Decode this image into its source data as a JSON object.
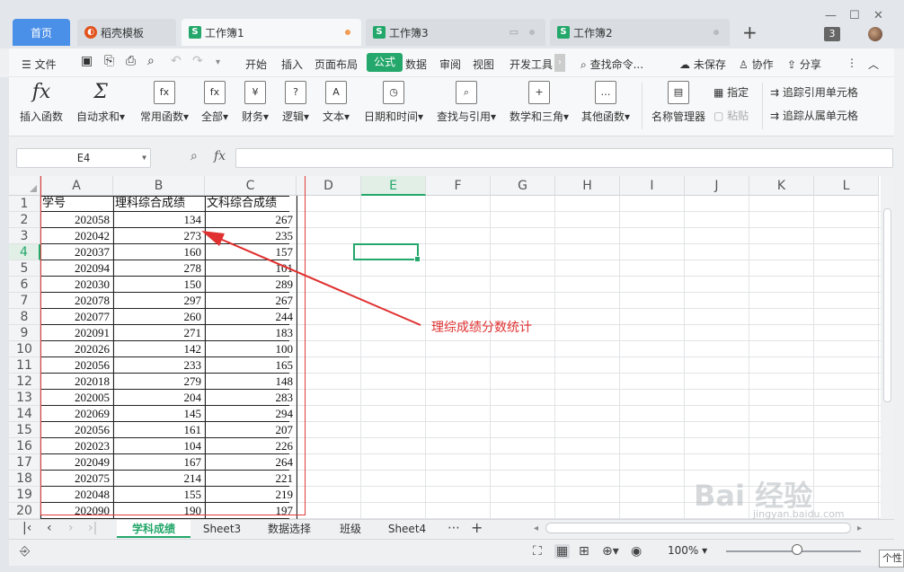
{
  "tabs": [
    {
      "label": "首页",
      "type": "home"
    },
    {
      "label": "稻壳模板",
      "type": "docer"
    },
    {
      "label": "工作簿1",
      "type": "active"
    },
    {
      "label": "工作簿3",
      "type": "normal"
    },
    {
      "label": "工作簿2",
      "type": "normal"
    }
  ],
  "window_badge": "3",
  "menu": {
    "file": "文件",
    "items": [
      "开始",
      "插入",
      "页面布局",
      "公式",
      "数据",
      "审阅",
      "视图",
      "开发工具"
    ],
    "active": "公式",
    "search": "查找命令...",
    "unsaved": "未保存",
    "collab": "协作",
    "share": "分享"
  },
  "ribbon": {
    "buttons": [
      {
        "label": "插入函数",
        "icon": "fx"
      },
      {
        "label": "自动求和",
        "icon": "Σ"
      },
      {
        "label": "常用函数",
        "icon": "fx"
      },
      {
        "label": "全部",
        "icon": "fx"
      },
      {
        "label": "财务",
        "icon": "¥"
      },
      {
        "label": "逻辑",
        "icon": "?"
      },
      {
        "label": "文本",
        "icon": "A"
      },
      {
        "label": "日期和时间",
        "icon": "◷"
      },
      {
        "label": "查找与引用",
        "icon": "⌕"
      },
      {
        "label": "数学和三角",
        "icon": "+"
      },
      {
        "label": "其他函数",
        "icon": "…"
      },
      {
        "label": "名称管理器",
        "icon": "▤"
      }
    ],
    "specify": "指定",
    "paste": "粘贴",
    "trace_precedents": "追踪引用单元格",
    "trace_dependents": "追踪从属单元格"
  },
  "namebox": "E4",
  "columns": [
    "A",
    "B",
    "C",
    "D",
    "E",
    "F",
    "G",
    "H",
    "I",
    "J",
    "K",
    "L"
  ],
  "selected_column": "E",
  "rows": [
    "1",
    "2",
    "3",
    "4",
    "5",
    "6",
    "7",
    "8",
    "9",
    "10",
    "11",
    "12",
    "13",
    "14",
    "15",
    "16",
    "17",
    "18",
    "19",
    "20"
  ],
  "selected_row": "4",
  "table": {
    "headers": [
      "学号",
      "理科综合成绩",
      "文科综合成绩"
    ],
    "data": [
      [
        "202058",
        "134",
        "267"
      ],
      [
        "202042",
        "273",
        "235"
      ],
      [
        "202037",
        "160",
        "157"
      ],
      [
        "202094",
        "278",
        "101"
      ],
      [
        "202030",
        "150",
        "289"
      ],
      [
        "202078",
        "297",
        "267"
      ],
      [
        "202077",
        "260",
        "244"
      ],
      [
        "202091",
        "271",
        "183"
      ],
      [
        "202026",
        "142",
        "100"
      ],
      [
        "202056",
        "233",
        "165"
      ],
      [
        "202018",
        "279",
        "148"
      ],
      [
        "202005",
        "204",
        "283"
      ],
      [
        "202069",
        "145",
        "294"
      ],
      [
        "202056",
        "161",
        "207"
      ],
      [
        "202023",
        "104",
        "226"
      ],
      [
        "202049",
        "167",
        "264"
      ],
      [
        "202075",
        "214",
        "221"
      ],
      [
        "202048",
        "155",
        "219"
      ],
      [
        "202090",
        "190",
        "197"
      ]
    ]
  },
  "annotation": "理综成绩分数统计",
  "accent_color": "#23a76a",
  "annotation_color": "#e03030",
  "sheet_tabs": [
    "学科成绩",
    "Sheet3",
    "数据选择",
    "班级",
    "Sheet4"
  ],
  "active_sheet": "学科成绩",
  "zoom": "100%",
  "tooltip": "个性",
  "watermark": "Bai 经验",
  "watermark_url": "jingyan.baidu.com"
}
